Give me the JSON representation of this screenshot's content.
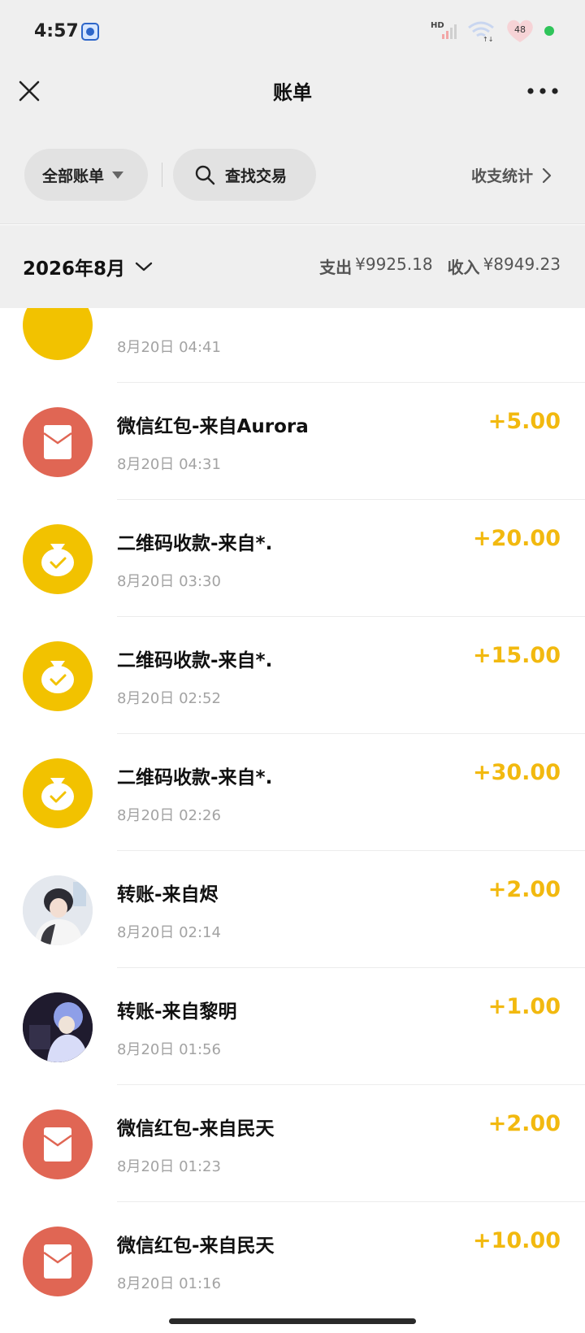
{
  "status_bar": {
    "time": "4:57",
    "network_label": "HD",
    "battery_level": "48"
  },
  "nav": {
    "title": "账单"
  },
  "filters": {
    "all_bills": "全部账单",
    "search": "查找交易",
    "stats": "收支统计"
  },
  "month_header": {
    "month": "2026年8月",
    "expense_label": "支出",
    "expense_value": "¥9925.18",
    "income_label": "收入",
    "income_value": "¥8949.23"
  },
  "colors": {
    "amount": "#f2b90f",
    "red_packet": "#e06654",
    "qr_payment": "#f2c200",
    "background": "#efefef"
  },
  "transactions": [
    {
      "icon": "qr-payment-icon",
      "title": "",
      "time": "8月20日 04:41",
      "amount": ""
    },
    {
      "icon": "red-packet-icon",
      "title": "微信红包-来自Aurora",
      "time": "8月20日 04:31",
      "amount": "+5.00"
    },
    {
      "icon": "qr-payment-icon",
      "title": "二维码收款-来自*.",
      "time": "8月20日 03:30",
      "amount": "+20.00"
    },
    {
      "icon": "qr-payment-icon",
      "title": "二维码收款-来自*.",
      "time": "8月20日 02:52",
      "amount": "+15.00"
    },
    {
      "icon": "qr-payment-icon",
      "title": "二维码收款-来自*.",
      "time": "8月20日 02:26",
      "amount": "+30.00"
    },
    {
      "icon": "user-avatar",
      "title": "转账-来自烬",
      "time": "8月20日 02:14",
      "amount": "+2.00"
    },
    {
      "icon": "user-avatar",
      "title": "转账-来自黎明",
      "time": "8月20日 01:56",
      "amount": "+1.00"
    },
    {
      "icon": "red-packet-icon",
      "title": "微信红包-来自民天",
      "time": "8月20日 01:23",
      "amount": "+2.00"
    },
    {
      "icon": "red-packet-icon",
      "title": "微信红包-来自民天",
      "time": "8月20日 01:16",
      "amount": "+10.00"
    }
  ]
}
